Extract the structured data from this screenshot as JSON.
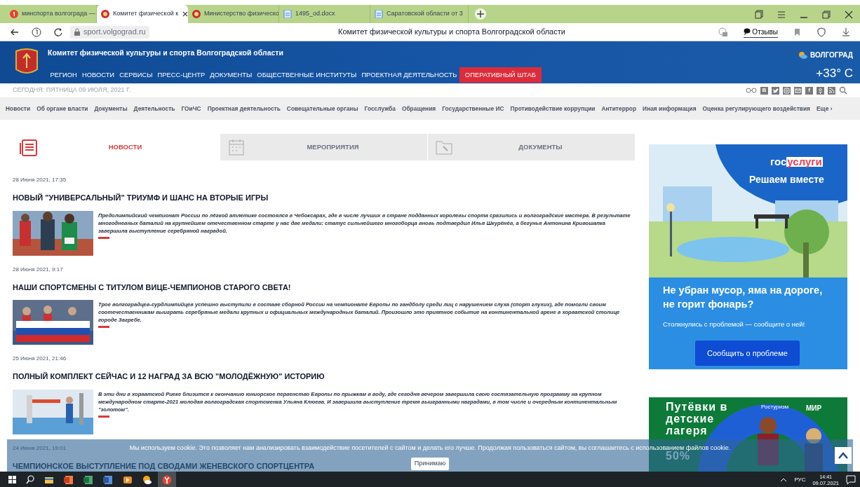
{
  "browser": {
    "tabs": [
      {
        "label": "минспорта волгограда —",
        "selected": false,
        "kind": "yandex"
      },
      {
        "label": "Комитет физической к",
        "selected": true,
        "kind": "emblem"
      },
      {
        "label": "Министерство физическо",
        "selected": false,
        "kind": "emblem"
      },
      {
        "label": "1495_od.docx",
        "selected": false,
        "kind": "doc"
      },
      {
        "label": "Саратовской области от 3",
        "selected": false,
        "kind": "doc"
      }
    ],
    "address": "sport.volgograd.ru",
    "page_title": "Комитет физической культуры и спорта Волгоградской области",
    "feedback": "Отзывы"
  },
  "header": {
    "title": "Комитет физической культуры и спорта Волгоградской области",
    "nav": [
      {
        "label": "РЕГИОН",
        "selected": false
      },
      {
        "label": "НОВОСТИ",
        "selected": false
      },
      {
        "label": "СЕРВИСЫ",
        "selected": false
      },
      {
        "label": "ПРЕСС-ЦЕНТР",
        "selected": false
      },
      {
        "label": "ДОКУМЕНТЫ",
        "selected": false
      },
      {
        "label": "ОБЩЕСТВЕННЫЕ ИНСТИТУТЫ",
        "selected": false
      },
      {
        "label": "ПРОЕКТНАЯ ДЕЯТЕЛЬНОСТЬ",
        "selected": false
      },
      {
        "label": "ОПЕРАТИВНЫЙ ШТАБ",
        "selected": true
      }
    ],
    "city": "ВОЛГОГРАД",
    "temperature": "+33° C"
  },
  "date_line": "СЕГОДНЯ: ПЯТНИЦА 09 ИЮЛЯ, 2021 Г.",
  "social": [
    {
      "label": "В",
      "kind": "text"
    },
    {
      "kind": "twitter"
    },
    {
      "kind": "instagram"
    },
    {
      "kind": "mail"
    },
    {
      "label": "f",
      "kind": "text"
    },
    {
      "kind": "ok"
    },
    {
      "kind": "rss"
    }
  ],
  "secondary_nav": [
    "Новости",
    "Об органе власти",
    "Документы",
    "Деятельность",
    "ГОиЧС",
    "Проектная деятельность",
    "Совещательные органы",
    "Госслужба",
    "Обращения",
    "Государственные ИС",
    "Противодействие коррупции",
    "Антитеррор",
    "Иная информация",
    "Оценка регулирующего воздействия",
    "Еще ›"
  ],
  "content_tabs": [
    {
      "label": "НОВОСТИ",
      "selected": true,
      "kind": "news"
    },
    {
      "label": "МЕРОПРИЯТИЯ",
      "selected": false,
      "kind": "calendar"
    },
    {
      "label": "ДОКУМЕНТЫ",
      "selected": false,
      "kind": "folder"
    }
  ],
  "news": [
    {
      "date": "28 Июня 2021, 17:35",
      "title": "НОВЫЙ \"УНИВЕРСАЛЬНЫЙ\" ТРИУМФ И ШАНС НА ВТОРЫЕ ИГРЫ",
      "text": "Предолимпийский чемпионат России по лёгкой атлетике состоялся в Чебоксарах, где в числе лучших в стране подданных королевы спорта сразились и волгоградские мастера. В результате многодневных баталий на крупнейшем отечественном старте у нас две медали: статус сильнейшего многоборца вновь подтвердил Илья Шкурёнёв, а бегунья Антонина Кривошапка завершила выступление серебряной наградой."
    },
    {
      "date": "28 Июня 2021, 9:17",
      "title": "НАШИ СПОРТСМЕНЫ С ТИТУЛОМ ВИЦЕ-ЧЕМПИОНОВ СТАРОГО СВЕТА!",
      "text": "Трое волгоградцев-сурдлимпийцев успешно выступили в составе сборной России на чемпионате Европы по гандболу среди лиц с нарушением слуха (спорт глухих), где помогли своим соотечественникам выиграть серебряные медали крупных и официальных международных баталий. Произошло это приятное событие на континентальной арене в хорватской столице городе Загребе."
    },
    {
      "date": "25 Июня 2021, 21:46",
      "title": "ПОЛНЫЙ КОМПЛЕКТ СЕЙЧАС И 12 НАГРАД ЗА ВСЮ \"МОЛОДЁЖНУЮ\" ИСТОРИЮ",
      "text": "В эти дни в хорватской Риеке близится к окончанию юниорское первенство Европы по прыжкам в воду, где сегодня вечером завершила свою состязательную программу на крупном международном старте-2021 молодая волгоградская спортсменка Ульяна Клюева. И завершила выступление тремя выигранными наградами, в том числе и очередным континентальным \"золотом\"."
    },
    {
      "date": "24 Июня 2021, 19:01",
      "title": "ЧЕМПИОНСКОЕ ВЫСТУПЛЕНИЕ ПОД СВОДАМИ ЖЕНЕВСКОГО СПОРТЦЕНТРА"
    }
  ],
  "banner_gosuslugi": {
    "logo_left": "гос",
    "logo_right": "услуги",
    "tagline": "Решаем вместе",
    "heading": "Не убран мусор, яма на дороге, не горит фонарь?",
    "subtext": "Столкнулись с проблемой — сообщите о ней!",
    "button": "Сообщить о проблеме"
  },
  "banner_camps": {
    "heading": "Путёвки в детские лагеря",
    "partner": "Ростуризм",
    "brand": "МИР",
    "line_4": "50%"
  },
  "cookie": {
    "text": "Мы используем cookie. Это позволяет нам анализировать взаимодействие посетителей с сайтом и делать его лучше. Продолжая пользоваться сайтом, вы соглашаетесь с использованием файлов cookie.",
    "button": "Принимаю"
  },
  "taskbar": {
    "apps": [
      {
        "kind": "explorer"
      },
      {
        "kind": "powerpoint"
      },
      {
        "kind": "excel"
      },
      {
        "kind": "word"
      },
      {
        "kind": "media"
      },
      {
        "kind": "weather"
      },
      {
        "kind": "yandex",
        "selected": true
      }
    ],
    "language": "РУС",
    "time": "14:41",
    "date": "09.07.2021"
  }
}
